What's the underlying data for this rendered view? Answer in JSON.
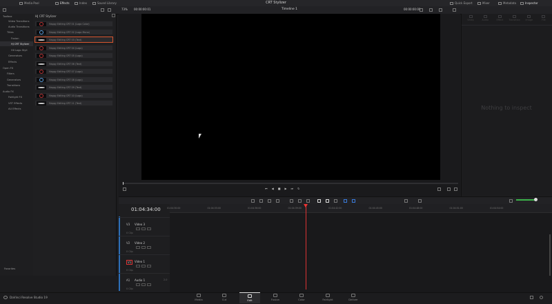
{
  "topbar": {
    "tabs": [
      "Media Pool",
      "Effects",
      "Index",
      "Sound Library"
    ],
    "app_title": "CRT Stylizer",
    "right_tabs": [
      "Quick Export",
      "Mixer",
      "Metadata",
      "Inspector"
    ]
  },
  "viewer": {
    "zoom": "73%",
    "timecode_left": "00:00:00:01",
    "timeline_name": "Timeline 1",
    "timecode_right": "00:00:00:00"
  },
  "sidebar": {
    "items": [
      {
        "label": "Toolbox"
      },
      {
        "label": "Video Transitions"
      },
      {
        "label": "Audio Transitions"
      },
      {
        "label": "Titles"
      },
      {
        "label": "Fusion"
      },
      {
        "label": "HJ CRT Stylizer"
      },
      {
        "label": "HII Logo Styli"
      },
      {
        "label": "Generators"
      },
      {
        "label": "Effects"
      },
      {
        "label": "Open FX"
      },
      {
        "label": "Filters"
      },
      {
        "label": "Generators"
      },
      {
        "label": "Transitions"
      },
      {
        "label": "Audio FX"
      },
      {
        "label": "Fairlight FX"
      },
      {
        "label": "VST Effects"
      },
      {
        "label": "AU Effects"
      }
    ],
    "favorites": "Favorites"
  },
  "fxpanel": {
    "title": "HJ CRT Stylizer",
    "rows": [
      "Happy Editing CRT 01 (Logo Color)",
      "Happy Editing CRT 02 (Logo Mono)",
      "Happy Editing CRT 03 (Text)",
      "Happy Editing CRT 04 (Logo)",
      "Happy Editing CRT 05 (Logo)",
      "Happy Editing CRT 06 (Text)",
      "Happy Editing CRT 07 (Logo)",
      "Happy Editing CRT 08 (Logo)",
      "Happy Editing CRT 09 (Text)",
      "Happy Editing CRT 10 (Logo)",
      "Happy Editing CRT 11 (Text)"
    ]
  },
  "inspector": {
    "tabs": [
      "Video",
      "Audio",
      "Effect",
      "Transition",
      "Image",
      "File"
    ],
    "empty_text": "Nothing to inspect"
  },
  "timeline": {
    "timecode": "01:04:34:00",
    "ruler": [
      "01:04:30:00",
      "01:04:33:00",
      "01:04:36:00",
      "01:04:39:00",
      "01:04:42:00",
      "01:04:45:00",
      "01:04:48:00",
      "01:04:51:00",
      "01:04:54:00"
    ],
    "tracks": [
      {
        "id": "V3",
        "name": "Video 3",
        "clips": "0 Clip"
      },
      {
        "id": "V2",
        "name": "Video 2",
        "clips": "0 Clip"
      },
      {
        "id": "V1",
        "name": "Video 1",
        "clips": "0 Clip"
      },
      {
        "id": "A1",
        "name": "Audio 1",
        "clips": "0 Clip",
        "level": "2.0"
      }
    ]
  },
  "bottombar": {
    "brand": "DaVinci Resolve Studio 19",
    "pages": [
      "Media",
      "Cut",
      "Edit",
      "Fusion",
      "Color",
      "Fairlight",
      "Deliver"
    ],
    "active": "Edit"
  },
  "colors": {
    "accent_selected": "#d9562f",
    "playhead": "#dd3333",
    "volume": "#3bb34a"
  }
}
